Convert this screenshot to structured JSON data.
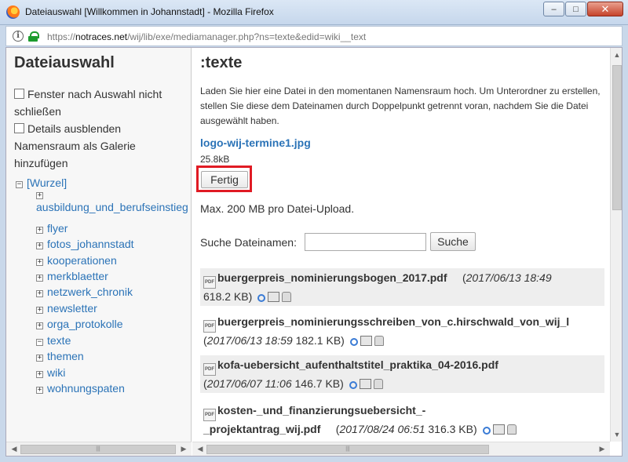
{
  "window": {
    "title": "Dateiauswahl [Willkommen in Johannstadt] - Mozilla Firefox",
    "minimize": "–",
    "maximize": "□",
    "close": "✕"
  },
  "urlbar": {
    "prefix": "https://",
    "domain": "notraces.net",
    "path": "/wij/lib/exe/mediamanager.php?ns=texte&edid=wiki__text"
  },
  "left": {
    "title": "Dateiauswahl",
    "option1": "Fenster nach Auswahl nicht schließen",
    "option2": "Details ausblenden",
    "option3": "Namensraum als Galerie hinzufügen",
    "root_toggle": "−",
    "root_label": "[Wurzel]",
    "namespaces": [
      {
        "label": "ausbildung_und_berufseinstieg",
        "toggle": "+"
      },
      {
        "label": "flyer",
        "toggle": "+"
      },
      {
        "label": "fotos_johannstadt",
        "toggle": "+"
      },
      {
        "label": "kooperationen",
        "toggle": "+"
      },
      {
        "label": "merkblaetter",
        "toggle": "+"
      },
      {
        "label": "netzwerk_chronik",
        "toggle": "+"
      },
      {
        "label": "newsletter",
        "toggle": "+"
      },
      {
        "label": "orga_protokolle",
        "toggle": "+"
      },
      {
        "label": "texte",
        "toggle": "−"
      },
      {
        "label": "themen",
        "toggle": "+"
      },
      {
        "label": "wiki",
        "toggle": "+"
      },
      {
        "label": "wohnungspaten",
        "toggle": "+"
      }
    ]
  },
  "right": {
    "title": ":texte",
    "intro": "Laden Sie hier eine Datei in den momentanen Namensraum hoch. Um Unterordner zu erstellen, stellen Sie diese dem Dateinamen durch Doppelpunkt getrennt voran, nachdem Sie die Datei ausgewählt haben.",
    "uploaded_file": "logo-wij-termine1.jpg",
    "uploaded_size": "25.8kB",
    "done_button": "Fertig",
    "max_upload": "Max. 200 MB pro Datei-Upload.",
    "search_label": "Suche Dateinamen:",
    "search_button": "Suche",
    "search_value": "",
    "files": [
      {
        "name": "buergerpreis_nominierungsbogen_2017.pdf",
        "date": "2017/06/13 18:49",
        "size": "618.2 KB"
      },
      {
        "name": "buergerpreis_nominierungsschreiben_von_c.hirschwald_von_wij_l",
        "date": "2017/06/13 18:59",
        "size": "182.1 KB"
      },
      {
        "name": "kofa-uebersicht_aufenthaltstitel_praktika_04-2016.pdf",
        "date": "2017/06/07 11:06",
        "size": "146.7 KB"
      },
      {
        "name": "kosten-_und_finanzierungsuebersicht_-",
        "name2": "_projektantrag_wij.pdf",
        "date": "2017/08/24 06:51",
        "size": "316.3 KB"
      }
    ],
    "pdf_label": "PDF"
  },
  "scroll": {
    "grip": "|||"
  }
}
